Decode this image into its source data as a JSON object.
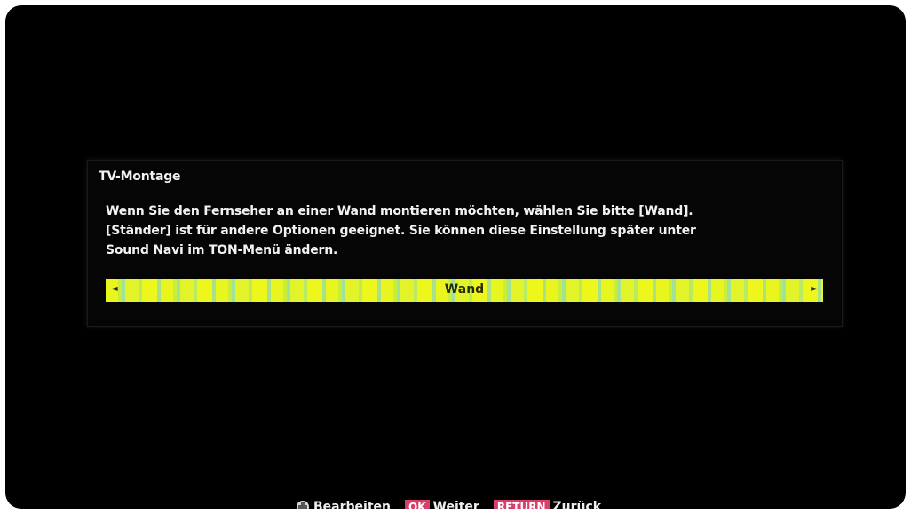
{
  "dialog": {
    "title": "TV-Montage",
    "description_lines": [
      "Wenn Sie den Fernseher an einer Wand montieren möchten, wählen Sie bitte [Wand].",
      "[Ständer] ist für andere Optionen geeignet. Sie können diese Einstellung später unter",
      "Sound Navi im TON-Menü ändern."
    ],
    "selector": {
      "value": "Wand",
      "left_arrow": "◄",
      "right_arrow": "►"
    }
  },
  "footer": {
    "edit_icon": "dpad-icon",
    "edit_label": "Bearbeiten",
    "ok_key": "OK",
    "ok_label": "Weiter",
    "return_key": "RETURN",
    "return_label": "Zurück"
  },
  "colors": {
    "background": "#000000",
    "selector_highlight": "#e8f51e",
    "key_badge": "#d6406a",
    "text": "#f2f2f2"
  }
}
